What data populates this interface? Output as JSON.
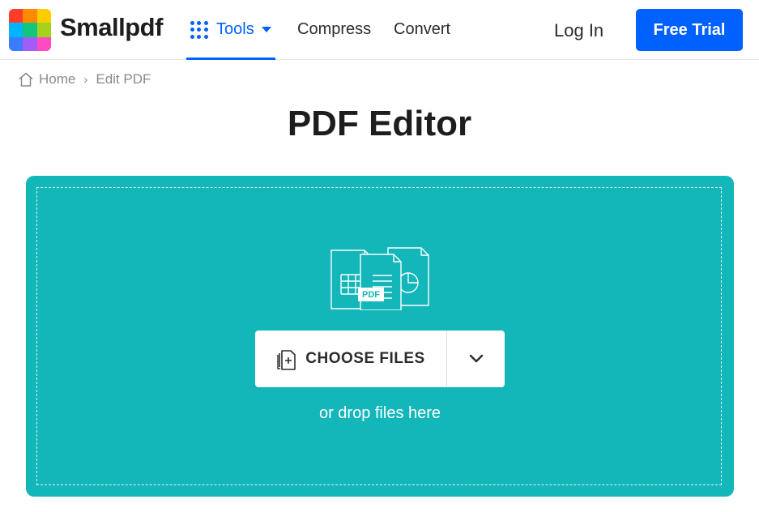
{
  "header": {
    "brand": "Smallpdf",
    "logo_colors": [
      "#ff3c28",
      "#ff8a00",
      "#ffcc00",
      "#00b4ff",
      "#12c77d",
      "#a3d31c",
      "#3a7bff",
      "#a25cf7",
      "#ff4bbf"
    ],
    "nav": {
      "tools_label": "Tools",
      "compress_label": "Compress",
      "convert_label": "Convert"
    },
    "login_label": "Log In",
    "trial_label": "Free Trial"
  },
  "breadcrumb": {
    "home_label": "Home",
    "separator": "›",
    "current_label": "Edit PDF"
  },
  "page_title": "PDF Editor",
  "dropzone": {
    "choose_files_label": "CHOOSE FILES",
    "drop_text": "or drop files here",
    "badge_text": "PDF"
  },
  "colors": {
    "accent": "#0061fe",
    "dropzone": "#13b6b9"
  }
}
